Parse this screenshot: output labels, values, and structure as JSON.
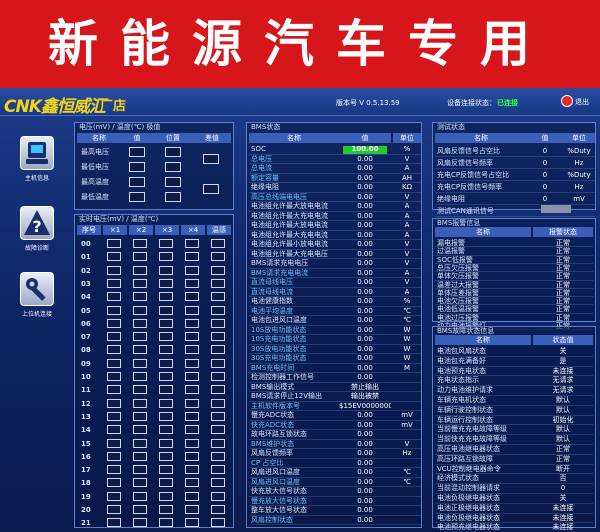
{
  "banner": {
    "text": "新能源汽车专用"
  },
  "header": {
    "logo_text": "CNK鑫恒威汇",
    "shop": "厂店",
    "version": "版本号 V 0.5.13.59",
    "conn_label": "设备连接状态：",
    "conn_value": "已连接",
    "exit_label": "退出"
  },
  "nav": {
    "items": [
      {
        "label": "主机信息"
      },
      {
        "label": "故障诊断"
      },
      {
        "label": "上位机连接"
      }
    ]
  },
  "volt_temp": {
    "title": "电压(mV) / 温度(℃) 极值",
    "cols": [
      "名称",
      "值",
      "位置",
      "差值"
    ],
    "rows": [
      "最高电压",
      "最低电压",
      "最高温度",
      "最低温度"
    ]
  },
  "cells": {
    "title": "实时电压(mV) / 温度(℃)",
    "cols": [
      "序号",
      "×1",
      "×2",
      "×3",
      "×4",
      "温感"
    ],
    "rows": [
      "00",
      "01",
      "02",
      "03",
      "04",
      "05",
      "06",
      "07",
      "08",
      "09",
      "10",
      "11",
      "12",
      "13",
      "14",
      "15",
      "16",
      "17",
      "18",
      "19",
      "20",
      "21"
    ]
  },
  "bms": {
    "title": "BMS状态",
    "cols": [
      "名称",
      "值",
      "单位"
    ],
    "rows": [
      {
        "name": "SOC",
        "value": "100.00",
        "unit": "%",
        "style": "bold"
      },
      {
        "name": "总电压",
        "value": "0.00",
        "unit": "V",
        "style": "blue"
      },
      {
        "name": "总电流",
        "value": "0.00",
        "unit": "A",
        "style": "blue"
      },
      {
        "name": "额定容量",
        "value": "0.00",
        "unit": "AH",
        "style": "blue"
      },
      {
        "name": "绝缘电阻",
        "value": "0.00",
        "unit": "KΩ",
        "style": "bold"
      },
      {
        "name": "高压总线端电电压",
        "value": "0.00",
        "unit": "V",
        "style": "blue"
      },
      {
        "name": "电池组允许最大放电电流",
        "value": "0.00",
        "unit": "A",
        "style": "bold"
      },
      {
        "name": "电池组允许最大充电电流",
        "value": "0.00",
        "unit": "A",
        "style": "bold"
      },
      {
        "name": "电池组允许最大放电电流",
        "value": "0.00",
        "unit": "A",
        "style": "bold"
      },
      {
        "name": "电池组允许最大充电电流",
        "value": "0.00",
        "unit": "A",
        "style": "bold"
      },
      {
        "name": "电池组允许最小放电电流",
        "value": "0.00",
        "unit": "V",
        "style": "bold"
      },
      {
        "name": "电池组允许最大充电电压",
        "value": "0.00",
        "unit": "V",
        "style": "bold"
      },
      {
        "name": "BMS请求充电电压",
        "value": "0.00",
        "unit": "V",
        "style": "bold"
      },
      {
        "name": "BMS请求充电电流",
        "value": "0.00",
        "unit": "A",
        "style": "blue"
      },
      {
        "name": "直流母线电压",
        "value": "0.00",
        "unit": "V",
        "style": "blue"
      },
      {
        "name": "直流母线电流",
        "value": "0.00",
        "unit": "A",
        "style": "blue"
      },
      {
        "name": "电池健康指数",
        "value": "0.00",
        "unit": "%",
        "style": "bold"
      },
      {
        "name": "电池平均温度",
        "value": "0.00",
        "unit": "℃",
        "style": "blue"
      },
      {
        "name": "电池包进风口温度",
        "value": "0.00",
        "unit": "℃",
        "style": "bold"
      },
      {
        "name": "10S放电功能状态",
        "value": "0.00",
        "unit": "W",
        "style": "blue"
      },
      {
        "name": "10S充电功能状态",
        "value": "0.00",
        "unit": "W",
        "style": "blue"
      },
      {
        "name": "30S放电功能状态",
        "value": "0.00",
        "unit": "W",
        "style": "blue"
      },
      {
        "name": "30S充电功能状态",
        "value": "0.00",
        "unit": "W",
        "style": "blue"
      },
      {
        "name": "BMS充电时间",
        "value": "0.00",
        "unit": "M",
        "style": "blue"
      },
      {
        "name": "检测控制器工作信号",
        "value": "0.00",
        "unit": "",
        "style": "bold"
      },
      {
        "name": "BMS输出模式",
        "value": "禁止输出",
        "unit": "",
        "style": "bold"
      },
      {
        "name": "BMS请求停止12V输出",
        "value": "输出被禁",
        "unit": "",
        "style": "bold"
      },
      {
        "name": "主机软件版本号",
        "value": "$15EV00000000",
        "unit": "",
        "style": "blue"
      },
      {
        "name": "慢充ADC状态",
        "value": "0.00",
        "unit": "mV",
        "style": "bold"
      },
      {
        "name": "快充ADC状态",
        "value": "0.00",
        "unit": "mV",
        "style": "blue"
      },
      {
        "name": "故电环路互锁状态",
        "value": "0.00",
        "unit": "",
        "style": "bold"
      },
      {
        "name": "BMS维护状态",
        "value": "0.00",
        "unit": "V",
        "style": "blue"
      },
      {
        "name": "风扇反馈频率",
        "value": "0.00",
        "unit": "Hz",
        "style": "bold"
      },
      {
        "name": "CP 占空比",
        "value": "0.00",
        "unit": "",
        "style": "blue"
      },
      {
        "name": "风扇进风口温度",
        "value": "0.00",
        "unit": "℃",
        "style": "bold"
      },
      {
        "name": "风扇进风口温度",
        "value": "0.00",
        "unit": "℃",
        "style": "blue"
      },
      {
        "name": "快充放大信号状态",
        "value": "0.00",
        "unit": "",
        "style": "bold"
      },
      {
        "name": "慢充放大信号状态",
        "value": "0.00",
        "unit": "",
        "style": "blue"
      },
      {
        "name": "整车放大信号状态",
        "value": "0.00",
        "unit": "",
        "style": "bold"
      },
      {
        "name": "风扇控制状态",
        "value": "0.00",
        "unit": "",
        "style": "blue"
      }
    ]
  },
  "test": {
    "title": "测试状态",
    "cols": [
      "名称",
      "值",
      "单位"
    ],
    "rows": [
      {
        "name": "风扇反馈信号占空比",
        "value": "0",
        "unit": "%Duty"
      },
      {
        "name": "风扇反馈信号频率",
        "value": "0",
        "unit": "Hz"
      },
      {
        "name": "充电CP反馈信号占空比",
        "value": "0",
        "unit": "%Duty"
      },
      {
        "name": "充电CP反馈信号频率",
        "value": "0",
        "unit": "Hz"
      },
      {
        "name": "绝缘电阻",
        "value": "0",
        "unit": "mV"
      },
      {
        "name": "测试CAN通讯信号",
        "value": "",
        "unit": ""
      }
    ]
  },
  "alarm": {
    "title": "BMS报警信息",
    "cols": [
      "名称",
      "报警状态"
    ],
    "rows": [
      {
        "name": "漏电报警",
        "value": "正常"
      },
      {
        "name": "过温报警",
        "value": "正常"
      },
      {
        "name": "SOC低报警",
        "value": "正常"
      },
      {
        "name": "总压欠压报警",
        "value": "正常"
      },
      {
        "name": "单体欠压报警",
        "value": "正常"
      },
      {
        "name": "温差过大报警",
        "value": "正常"
      },
      {
        "name": "单体压差报警",
        "value": "正常"
      },
      {
        "name": "电池欠压报警",
        "value": "正常"
      },
      {
        "name": "电池低温报警",
        "value": "正常"
      },
      {
        "name": "电池过压报警",
        "value": "正常"
      },
      {
        "name": "动力电池报警灯",
        "value": "正常"
      }
    ]
  },
  "fault": {
    "title": "BMS故障状态信息",
    "cols": [
      "名称",
      "状态值"
    ],
    "rows": [
      {
        "name": "电池包风扇状态",
        "value": "关"
      },
      {
        "name": "电池包充满备好",
        "value": "是"
      },
      {
        "name": "电池预充电状态",
        "value": "未连接"
      },
      {
        "name": "充电状态指示",
        "value": "无请求"
      },
      {
        "name": "动力电池维护请求",
        "value": "无请求"
      },
      {
        "name": "车辆充电机状态",
        "value": "默认"
      },
      {
        "name": "车辆行驶控制状态",
        "value": "默认"
      },
      {
        "name": "车辆运行控制状态",
        "value": "初始化"
      },
      {
        "name": "当前慢充充电故障等级",
        "value": "默认"
      },
      {
        "name": "当前快充充电故障等级",
        "value": "默认"
      },
      {
        "name": "高压电池继电器状态",
        "value": "正常"
      },
      {
        "name": "高压环路互锁故障",
        "value": "正常"
      },
      {
        "name": "VCU控制继电器命令",
        "value": "断开"
      },
      {
        "name": "经济模式状态",
        "value": "否"
      },
      {
        "name": "当前混动控制器请求",
        "value": "0"
      },
      {
        "name": "电池负极继电器状态",
        "value": "关"
      },
      {
        "name": "电池正极继电器状态",
        "value": "未连接"
      },
      {
        "name": "电池负极继电器状态",
        "value": "未连接"
      },
      {
        "name": "电池预充继电器状态",
        "value": "未连接"
      }
    ]
  }
}
